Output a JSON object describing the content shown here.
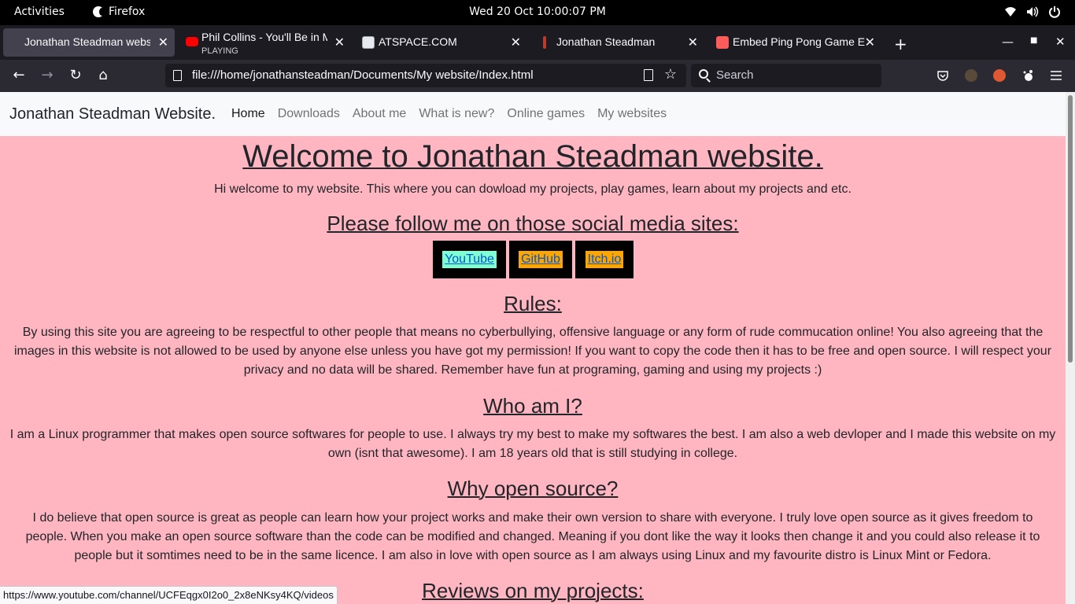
{
  "system": {
    "activities_label": "Activities",
    "app_label": "Firefox",
    "clock": "Wed 20 Oct  10:00:07 PM"
  },
  "tabs": [
    {
      "title": "Jonathan Steadman website",
      "active": true
    },
    {
      "title": "Phil Collins - You'll Be in My Heart",
      "subtitle": "PLAYING"
    },
    {
      "title": "ATSPACE.COM"
    },
    {
      "title": "Jonathan Steadman"
    },
    {
      "title": "Embed Ping Pong Game Easily"
    }
  ],
  "navbar": {
    "url": "file:///home/jonathansteadman/Documents/My website/Index.html",
    "search_placeholder": "Search"
  },
  "site": {
    "brand": "Jonathan Steadman Website.",
    "nav": [
      "Home",
      "Downloads",
      "About me",
      "What is new?",
      "Online games",
      "My websites"
    ],
    "heading": "Welcome to Jonathan Steadman website.",
    "intro": "Hi welcome to my website. This where you can dowload my projects, play games, learn about my projects and etc.",
    "social_heading": "Please follow me on those social media sites:",
    "social": [
      "YouTube",
      "GitHub",
      "Itch.io"
    ],
    "rules_heading": "Rules:",
    "rules_text": "By using this site you are agreeing to be respectful to other people that means no cyberbullying, offensive language or any form of rude commucation online! You also agreeing that the images in this website is not allowed to be used by anyone else unless you have got my permission! If you want to copy the code then it has to be free and open source. I will respect your privacy and no data will be shared. Remember have fun at programing, gaming and using my projects :)",
    "who_heading": "Who am I?",
    "who_text": "I am a Linux programmer that makes open source softwares for people to use. I always try my best to make my softwares the best. I am also a web devloper and I made this website on my own (isnt that awesome). I am 18 years old that is still studying in college.",
    "why_heading": "Why open source?",
    "why_text": "I do believe that open source is great as people can learn how your project works and make their own version to share with everyone. I truly love open source as it gives freedom to people. When you make an open source software than the code can be modified and changed. Meaning if you dont like the way it looks then change it and you could also release it to people but it somtimes need to be in the same licence. I am also in love with open source as I am always using Linux and my favourite distro is Linux Mint or Fedora.",
    "reviews_heading": "Reviews on my projects:"
  },
  "status_url": "https://www.youtube.com/channel/UCFEqgx0I2o0_2x8eNKsy4KQ/videos",
  "colors": {
    "page_bg": "#ffb6c1",
    "youtube_btn": "#7fffd4",
    "github_btn": "#ffa500",
    "itch_btn": "#ffa500"
  }
}
